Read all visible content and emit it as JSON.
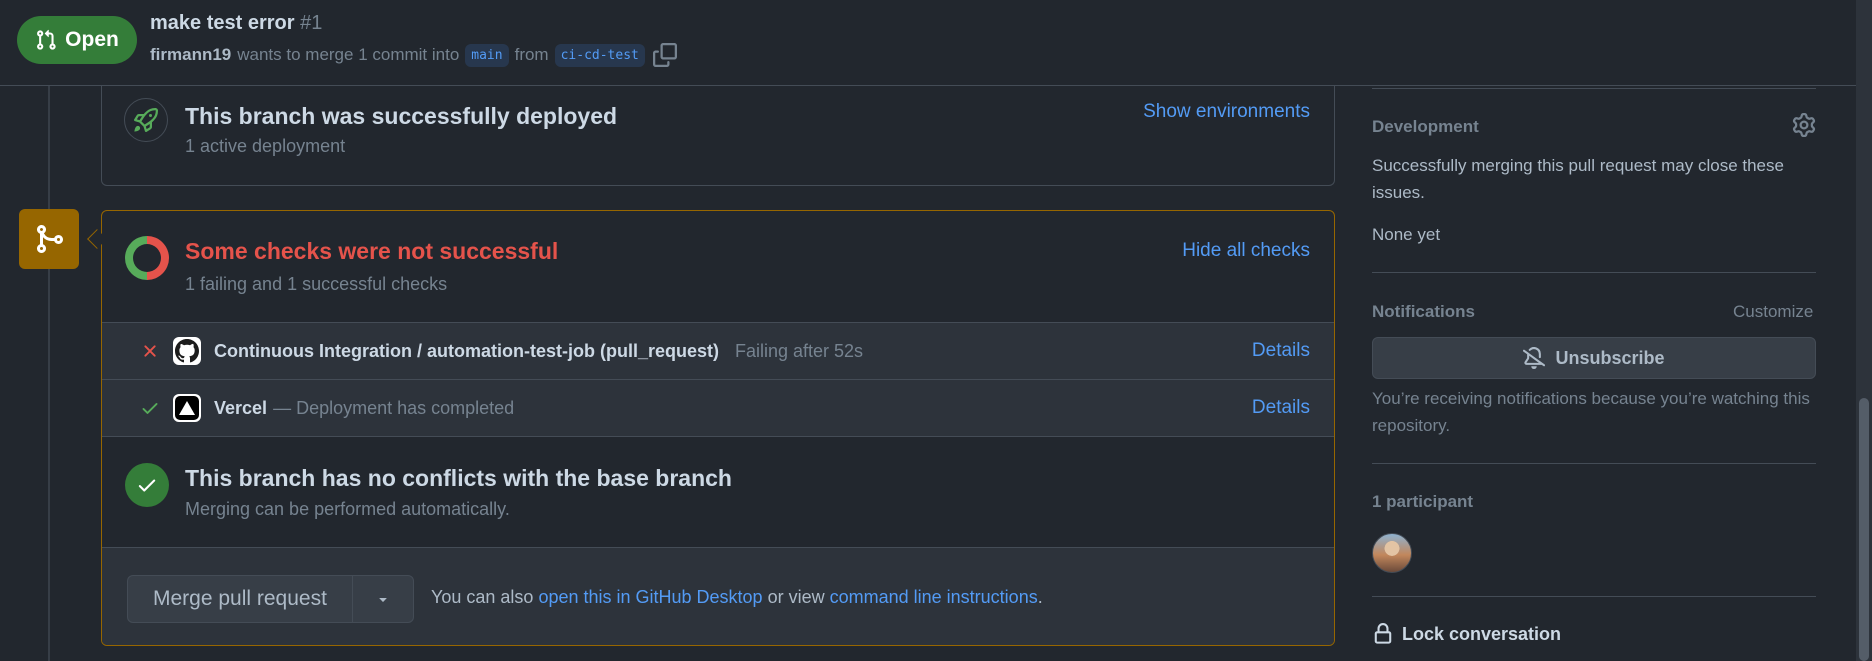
{
  "header": {
    "state_label": "Open",
    "title": "make test error",
    "number": "#1",
    "author": "firmann19",
    "merge_text": "wants to merge 1 commit into",
    "base_branch": "main",
    "from_text": "from",
    "head_branch": "ci-cd-test"
  },
  "deployment": {
    "title": "This branch was successfully deployed",
    "subtitle": "1 active deployment",
    "show_environments_label": "Show environments"
  },
  "checks": {
    "title": "Some checks were not successful",
    "subtitle": "1 failing and 1 successful checks",
    "hide_label": "Hide all checks",
    "items": [
      {
        "status": "failure",
        "icon": "github-icon",
        "name": "Continuous Integration / automation-test-job (pull_request)",
        "description": "Failing after 52s",
        "details_label": "Details"
      },
      {
        "status": "success",
        "icon": "vercel-icon",
        "name": "Vercel",
        "description": "— Deployment has completed",
        "details_label": "Details"
      }
    ]
  },
  "conflicts": {
    "title": "This branch has no conflicts with the base branch",
    "subtitle": "Merging can be performed automatically."
  },
  "merge": {
    "button_label": "Merge pull request",
    "hint_prefix": "You can also",
    "desktop_link": "open this in GitHub Desktop",
    "hint_mid": "or view",
    "cli_link": "command line instructions",
    "hint_suffix": "."
  },
  "sidebar": {
    "development": {
      "heading": "Development",
      "description": "Successfully merging this pull request may close these issues.",
      "empty": "None yet"
    },
    "notifications": {
      "heading": "Notifications",
      "customize_label": "Customize",
      "unsubscribe_label": "Unsubscribe",
      "reason": "You’re receiving notifications because you’re watching this repository."
    },
    "participants": {
      "heading": "1 participant"
    },
    "lock_label": "Lock conversation"
  },
  "colors": {
    "background": "#22272e",
    "open_green": "#347d39",
    "fail_red": "#e5534b",
    "success_green": "#57ab5a",
    "warning_border": "#966600",
    "link_blue": "#539bf5"
  }
}
